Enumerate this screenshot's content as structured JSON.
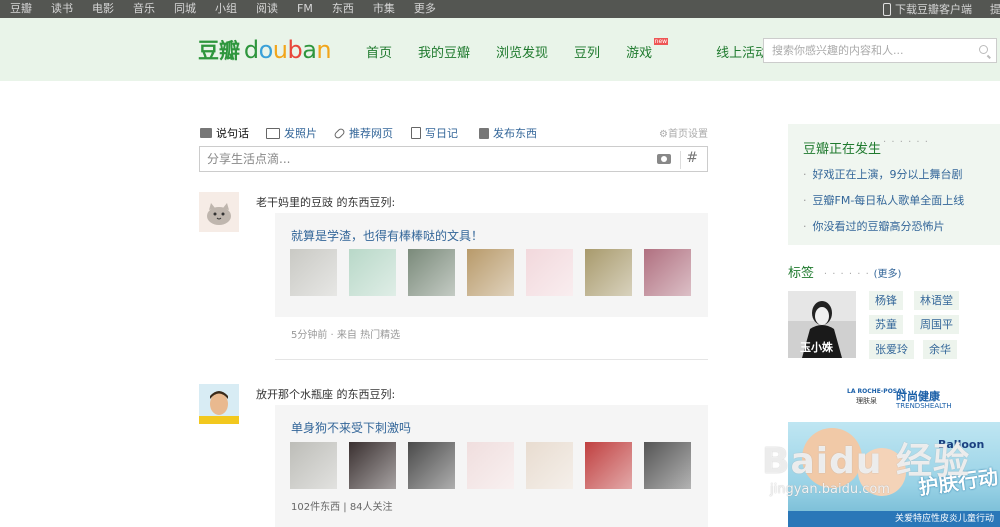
{
  "topbar": {
    "links": [
      "豆瓣",
      "读书",
      "电影",
      "音乐",
      "同城",
      "小组",
      "阅读",
      "FM",
      "东西",
      "市集",
      "更多"
    ],
    "download": "下载豆瓣客户端",
    "cut_label": "提醒"
  },
  "header": {
    "logo_cn": "豆瓣",
    "logo_en": "douban",
    "nav": [
      "首页",
      "我的豆瓣",
      "浏览发现",
      "豆列",
      "游戏",
      "线上活动"
    ],
    "new_badge": "new",
    "search_placeholder": "搜索你感兴趣的内容和人..."
  },
  "post_tabs": {
    "items": [
      "说句话",
      "发照片",
      "推荐网页",
      "写日记",
      "发布东西"
    ],
    "settings": "首页设置",
    "share_placeholder": "分享生活点滴...",
    "hash": "#"
  },
  "feed": [
    {
      "user": "老干妈里的豆豉",
      "action": "的东西豆列:",
      "card_title": "就算是学渣，也得有棒棒哒的文具！",
      "meta": "5分钟前 · 来自 热门精选",
      "thumbs": [
        "#c9c9c4",
        "#b8d8c8",
        "#7a8a7a",
        "#b89a6a",
        "#f2d8dc",
        "#a89a6c",
        "#b07080"
      ]
    },
    {
      "user": "放开那个水瓶座",
      "action": "的东西豆列:",
      "card_title": "单身狗不来受下刺激吗",
      "meta": "102件东西 | 84人关注",
      "thumbs": [
        "#bdbdb8",
        "#3a3030",
        "#4a4a4a",
        "#f0dede",
        "#e8dcd0",
        "#c04040",
        "#555555"
      ]
    }
  ],
  "happening": {
    "title": "豆瓣正在发生",
    "dots": "· · · · · ·",
    "items": [
      "好戏正在上演，9分以上舞台剧",
      "豆瓣FM-每日私人歌单全面上线",
      "你没看过的豆瓣高分恐怖片"
    ]
  },
  "tags": {
    "title": "标签",
    "dots": "· · · · · ·",
    "more": "(更多)",
    "photo_caption": "玉小姝",
    "names": [
      "杨锋",
      "林语堂",
      "苏童",
      "周国平",
      "张爱玲",
      "余华"
    ]
  },
  "ad": {
    "brand1": "LA ROCHE-POSAY",
    "brand1_cn": "理肤泉",
    "brand2": "时尚健康",
    "brand2_en": "TRENDSHEALTH",
    "balloon": "Balloon",
    "slogan": "护肤行动",
    "footer": "关爱特应性皮炎儿童行动"
  },
  "watermark": {
    "main": "Baidu 经验",
    "sub": "jingyan.baidu.com"
  },
  "colors": {
    "brand_green": "#2e963d",
    "nav_green": "#1f7a2e",
    "link_blue": "#336699",
    "topbar_bg": "#545652",
    "header_bg": "#e9f4e9"
  }
}
